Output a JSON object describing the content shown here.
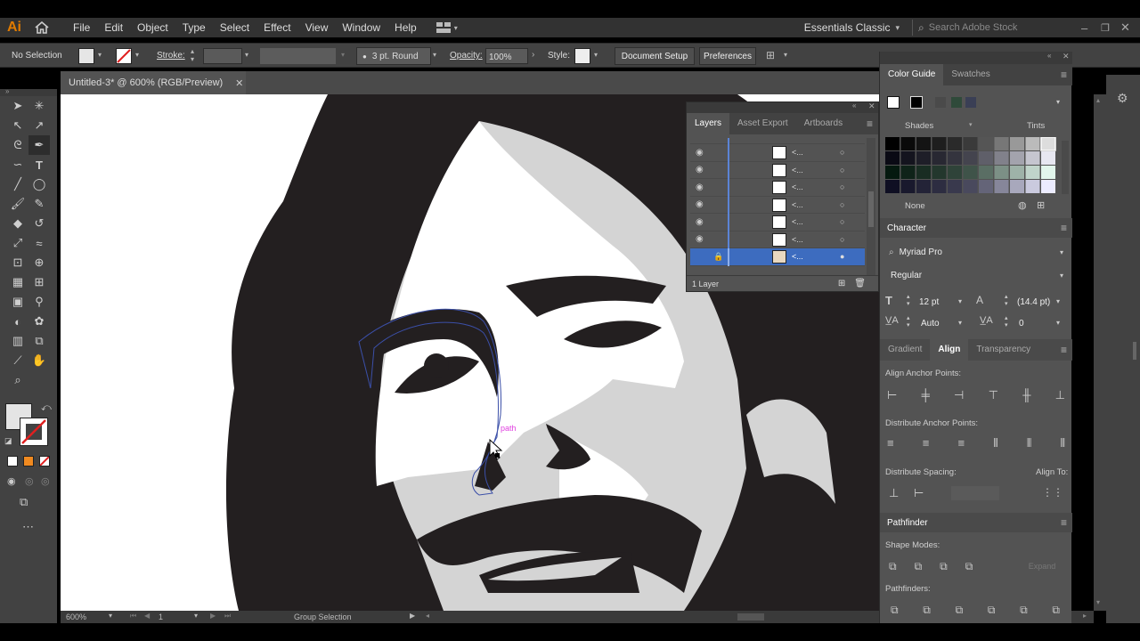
{
  "app": {
    "logo": "Ai",
    "workspace": "Essentials Classic",
    "search_placeholder": "Search Adobe Stock"
  },
  "menu": [
    "File",
    "Edit",
    "Object",
    "Type",
    "Select",
    "Effect",
    "View",
    "Window",
    "Help"
  ],
  "control": {
    "selection": "No Selection",
    "stroke_label": "Stroke:",
    "brush": "3 pt. Round",
    "opacity_label": "Opacity:",
    "opacity_value": "100%",
    "style_label": "Style:",
    "doc_setup": "Document Setup",
    "preferences": "Preferences"
  },
  "document": {
    "tab_title": "Untitled-3* @ 600% (RGB/Preview)",
    "tooltip": "path"
  },
  "status": {
    "zoom": "600%",
    "artboard": "1",
    "tool": "Group Selection"
  },
  "layers": {
    "tabs": [
      "Layers",
      "Asset Export",
      "Artboards"
    ],
    "rows": [
      "<...",
      "<...",
      "<...",
      "<...",
      "<...",
      "<...",
      "<..."
    ],
    "footer": "1 Layer"
  },
  "color_guide": {
    "tabs": [
      "Color Guide",
      "Swatches"
    ],
    "shades": "Shades",
    "tints": "Tints",
    "none": "None"
  },
  "character": {
    "title": "Character",
    "font": "Myriad Pro",
    "style": "Regular",
    "size": "12 pt",
    "leading": "(14.4 pt)",
    "kerning": "Auto",
    "tracking": "0"
  },
  "align": {
    "tabs": [
      "Gradient",
      "Align",
      "Transparency"
    ],
    "anchor_label": "Align Anchor Points:",
    "dist_anchor_label": "Distribute Anchor Points:",
    "dist_spacing_label": "Distribute Spacing:",
    "align_to": "Align To:"
  },
  "pathfinder": {
    "title": "Pathfinder",
    "shape_modes": "Shape Modes:",
    "expand": "Expand",
    "pathfinders": "Pathfinders:"
  },
  "colors": {
    "ui_dark": "#323232",
    "ui_mid": "#535353",
    "selection_blue": "#3d6cbf",
    "accent_orange": "#e07b00"
  }
}
